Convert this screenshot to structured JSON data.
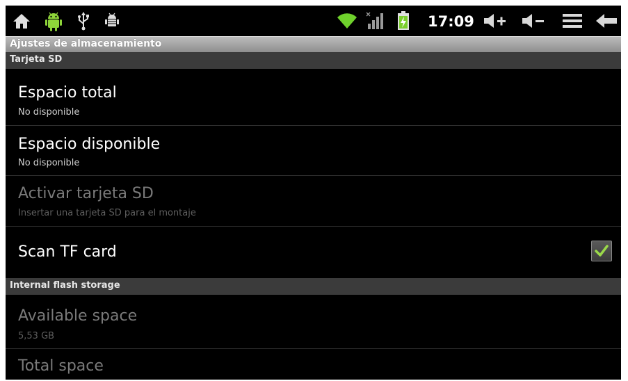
{
  "status_bar": {
    "left_icons": [
      "home-icon",
      "android-icon",
      "usb-icon",
      "debug-icon"
    ],
    "right_icons": [
      "wifi-icon",
      "signal-icon",
      "battery-charging-icon"
    ],
    "time": "17:09",
    "buttons": [
      "volume-up-icon",
      "volume-down-icon",
      "menu-icon",
      "back-icon"
    ]
  },
  "title": "Ajustes de almacenamiento",
  "sections": {
    "sd": {
      "header": "Tarjeta SD",
      "items": [
        {
          "title": "Espacio total",
          "summary": "No disponible"
        },
        {
          "title": "Espacio disponible",
          "summary": "No disponible"
        },
        {
          "title": "Activar tarjeta SD",
          "summary": "Insertar una tarjeta SD para el montaje"
        },
        {
          "title": "Scan TF card",
          "checked": true
        }
      ]
    },
    "internal": {
      "header": "Internal flash storage",
      "items": [
        {
          "title": "Available space",
          "summary": "5,53 GB"
        },
        {
          "title": "Total space"
        }
      ]
    }
  },
  "colors": {
    "accent_green": "#8ed43a",
    "checkmark": "#9bd94a"
  }
}
